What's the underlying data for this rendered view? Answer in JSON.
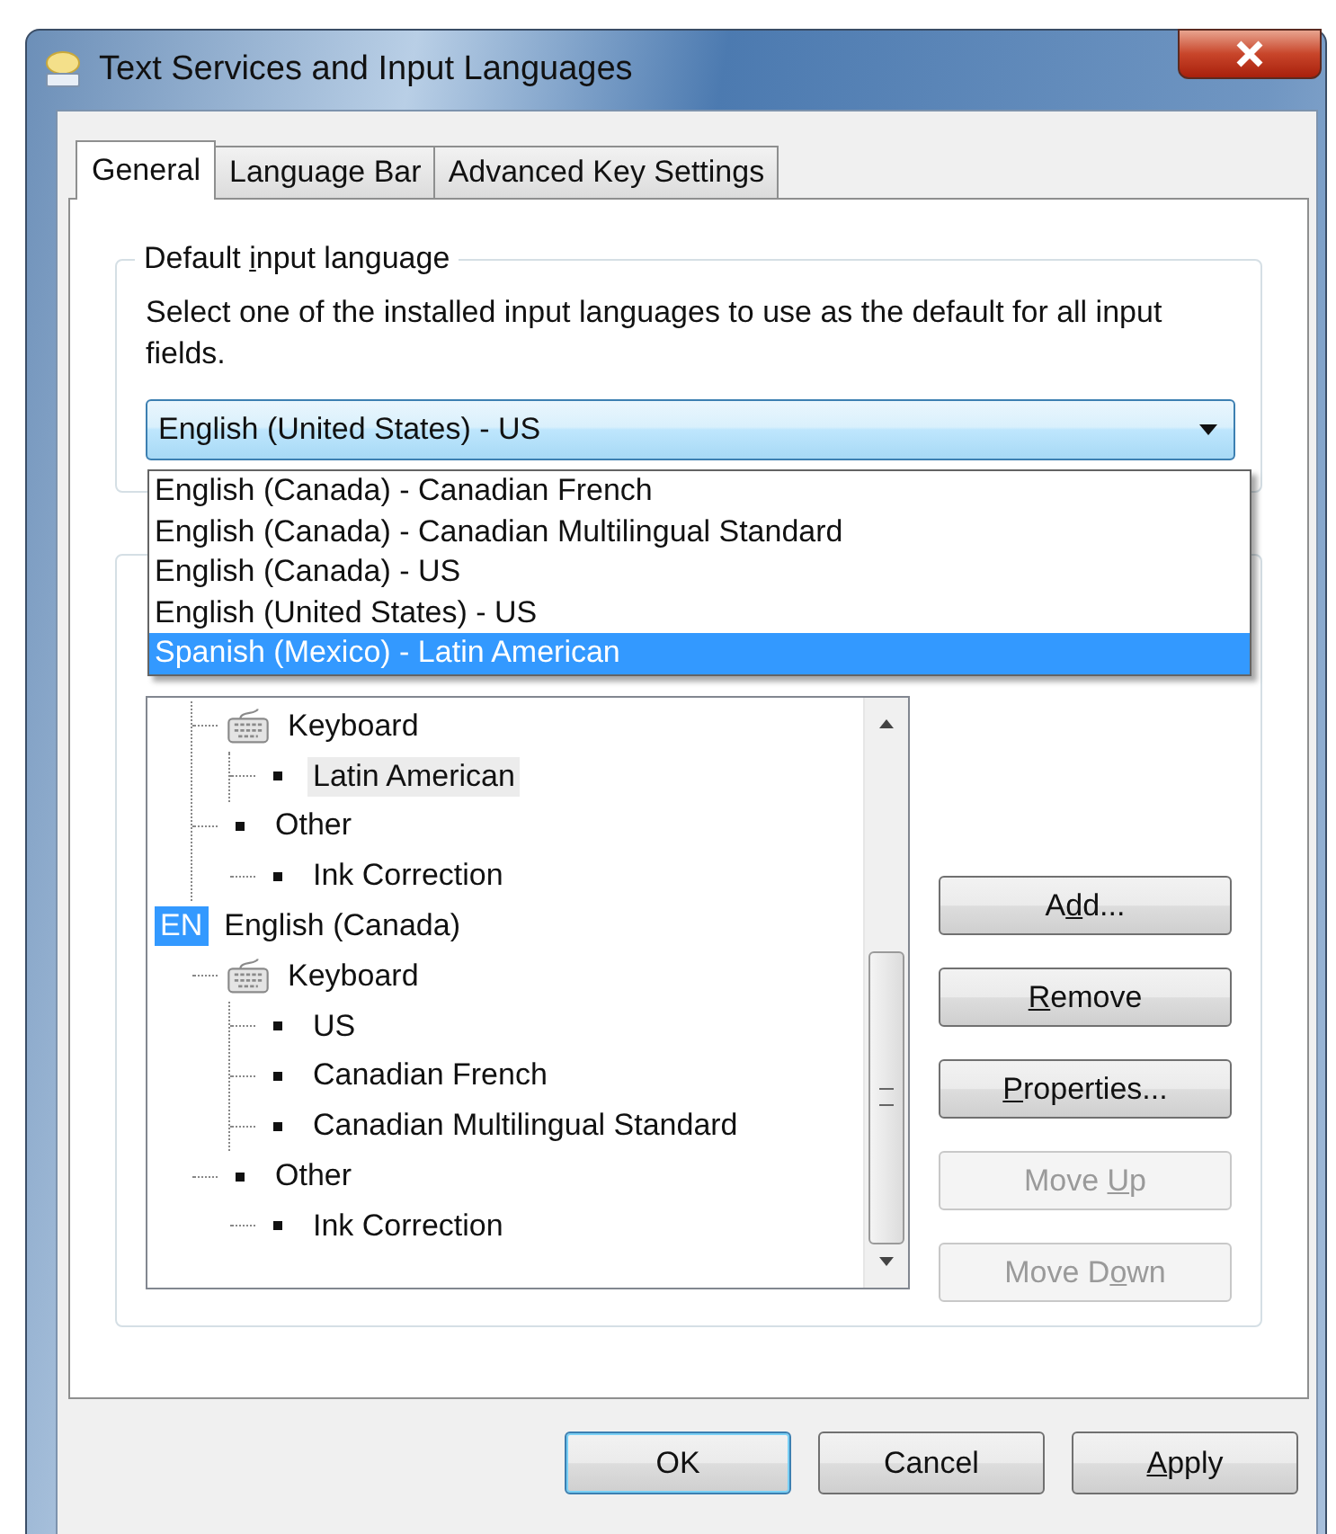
{
  "window": {
    "title": "Text Services and Input Languages"
  },
  "tabs": [
    {
      "label": "General",
      "selected": true
    },
    {
      "label": "Language Bar",
      "selected": false
    },
    {
      "label": "Advanced Key Settings",
      "selected": false
    }
  ],
  "default_input_language": {
    "legend": {
      "before": "Default ",
      "access_key": "i",
      "after": "nput language"
    },
    "description": "Select one of the installed input languages to use as the default for all input fields.",
    "combo": {
      "value": "English (United States) - US",
      "expanded": true,
      "options": [
        {
          "label": "English (Canada) - Canadian French",
          "highlighted": false
        },
        {
          "label": "English (Canada) - Canadian Multilingual Standard",
          "highlighted": false
        },
        {
          "label": "English (Canada) - US",
          "highlighted": false
        },
        {
          "label": "English (United States) - US",
          "highlighted": false
        },
        {
          "label": "Spanish (Mexico) - Latin American",
          "highlighted": true
        }
      ]
    }
  },
  "installed_services": {
    "tree": [
      {
        "kind": "offscreen",
        "children": [
          {
            "kind": "keyboard",
            "label": "Keyboard",
            "selected": false,
            "children": [
              {
                "kind": "bullet",
                "label": "Latin American",
                "selected": true
              }
            ]
          },
          {
            "kind": "bullet",
            "label": "Other",
            "selected": false,
            "children": [
              {
                "kind": "bullet",
                "label": "Ink Correction",
                "selected": false
              }
            ]
          }
        ]
      },
      {
        "kind": "language",
        "badge": "EN",
        "label": "English (Canada)",
        "selected": false,
        "children": [
          {
            "kind": "keyboard",
            "label": "Keyboard",
            "selected": false,
            "children": [
              {
                "kind": "bullet",
                "label": "US",
                "selected": false
              },
              {
                "kind": "bullet",
                "label": "Canadian French",
                "selected": false
              },
              {
                "kind": "bullet",
                "label": "Canadian Multilingual Standard",
                "selected": false
              }
            ]
          },
          {
            "kind": "bullet",
            "label": "Other",
            "selected": false,
            "children": [
              {
                "kind": "bullet",
                "label": "Ink Correction",
                "selected": false
              }
            ]
          }
        ]
      }
    ],
    "buttons": [
      {
        "label": {
          "before": "A",
          "access_key": "d",
          "after": "d..."
        },
        "disabled": false
      },
      {
        "label": {
          "access_key": "R",
          "after": "emove"
        },
        "disabled": false
      },
      {
        "label": {
          "access_key": "P",
          "after": "roperties..."
        },
        "disabled": false
      },
      {
        "label": {
          "before": "Move ",
          "access_key": "U",
          "after": "p"
        },
        "disabled": true
      },
      {
        "label": {
          "before": "Move D",
          "access_key": "o",
          "after": "wn"
        },
        "disabled": true
      }
    ]
  },
  "dialog_buttons": [
    {
      "label": "OK",
      "default": true
    },
    {
      "label": "Cancel",
      "default": false
    },
    {
      "label": {
        "access_key": "A",
        "after": "pply"
      },
      "default": false
    }
  ]
}
